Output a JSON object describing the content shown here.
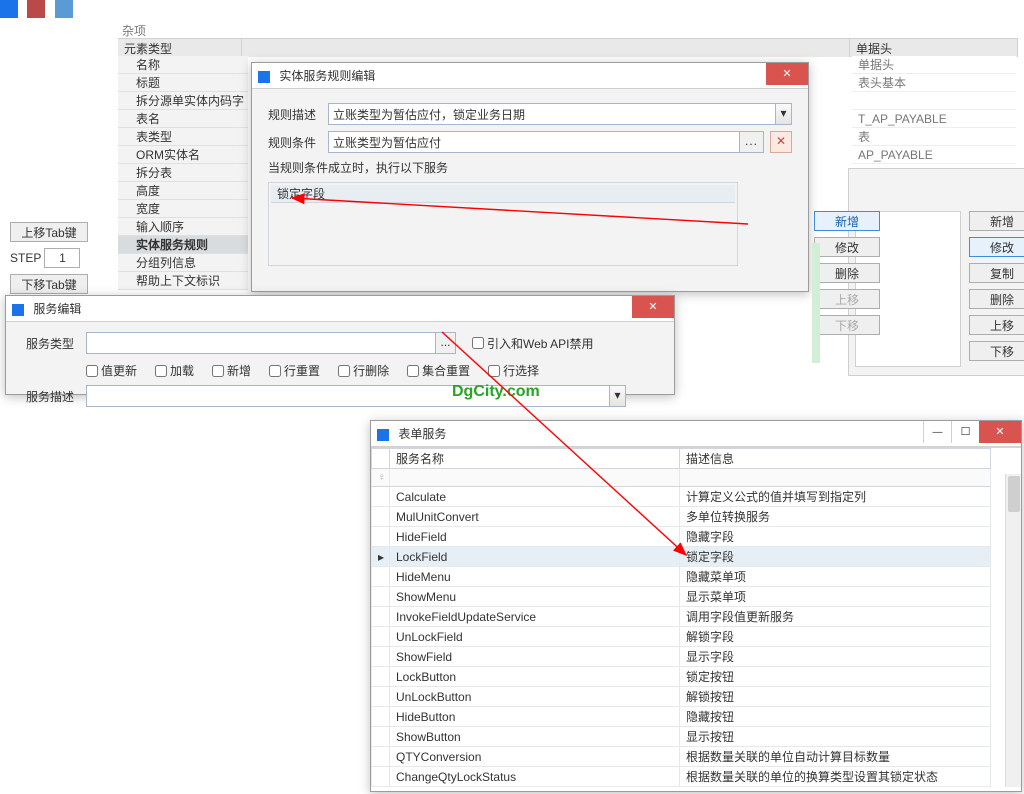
{
  "misc_label": "杂项",
  "prop_header": {
    "c1": "元素类型",
    "c2": "",
    "c3": "单据头"
  },
  "prop_rows": [
    "名称",
    "标题",
    "拆分源单实体内码字",
    "表名",
    "表类型",
    "ORM实体名",
    "拆分表",
    "高度",
    "宽度",
    "输入顺序",
    "实体服务规则",
    "分组列信息",
    "帮助上下文标识"
  ],
  "right_vals": [
    "单据头",
    "表头基本",
    "",
    "T_AP_PAYABLE",
    "表",
    "AP_PAYABLE"
  ],
  "step": {
    "up": "上移Tab键",
    "label": "STEP",
    "val": "1",
    "down": "下移Tab键"
  },
  "rule_dlg": {
    "title": "实体服务规则编辑",
    "desc_label": "规则描述",
    "desc_val": "立账类型为暂估应付，锁定业务日期",
    "cond_label": "规则条件",
    "cond_val": "立账类型为暂估应付",
    "caption": "当规则条件成立时，执行以下服务",
    "table_header": "锁定字段",
    "buttons": [
      "新增",
      "修改",
      "删除",
      "上移",
      "下移"
    ]
  },
  "side2": {
    "buttons": [
      "新增",
      "修改",
      "复制",
      "删除",
      "上移",
      "下移"
    ]
  },
  "svc_dlg": {
    "title": "服务编辑",
    "type_label": "服务类型",
    "chk_api": "引入和Web API禁用",
    "checks": [
      "值更新",
      "加载",
      "新增",
      "行重置",
      "行删除",
      "集合重置",
      "行选择"
    ],
    "desc_label": "服务描述"
  },
  "watermark": "DgCity.com",
  "form_dlg": {
    "title": "表单服务",
    "col1": "服务名称",
    "col2": "描述信息",
    "rows": [
      [
        "Calculate",
        "计算定义公式的值并填写到指定列"
      ],
      [
        "MulUnitConvert",
        "多单位转换服务"
      ],
      [
        "HideField",
        "隐藏字段"
      ],
      [
        "LockField",
        "锁定字段"
      ],
      [
        "HideMenu",
        "隐藏菜单项"
      ],
      [
        "ShowMenu",
        "显示菜单项"
      ],
      [
        "InvokeFieldUpdateService",
        "调用字段值更新服务"
      ],
      [
        "UnLockField",
        "解锁字段"
      ],
      [
        "ShowField",
        "显示字段"
      ],
      [
        "LockButton",
        "锁定按钮"
      ],
      [
        "UnLockButton",
        "解锁按钮"
      ],
      [
        "HideButton",
        "隐藏按钮"
      ],
      [
        "ShowButton",
        "显示按钮"
      ],
      [
        "QTYConversion",
        "根据数量关联的单位自动计算目标数量"
      ],
      [
        "ChangeQtyLockStatus",
        "根据数量关联的单位的换算类型设置其锁定状态"
      ]
    ],
    "selected_index": 3
  }
}
